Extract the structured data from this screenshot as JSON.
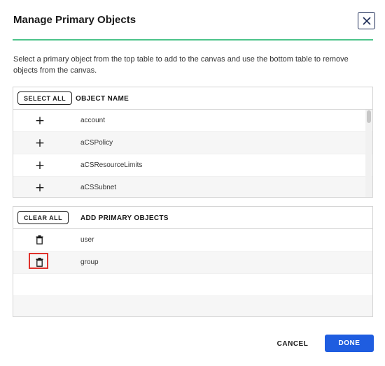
{
  "dialog": {
    "title": "Manage Primary Objects",
    "description": "Select a primary object from the top table to add to the canvas and use the bottom table to remove objects from the canvas."
  },
  "top_table": {
    "button_label": "SELECT ALL",
    "column_header": "OBJECT NAME",
    "row_action_icon": "plus-icon",
    "rows": [
      {
        "name": "account"
      },
      {
        "name": "aCSPolicy"
      },
      {
        "name": "aCSResourceLimits"
      },
      {
        "name": "aCSSubnet"
      }
    ]
  },
  "bottom_table": {
    "button_label": "CLEAR ALL",
    "column_header": "ADD PRIMARY OBJECTS",
    "row_action_icon": "trash-icon",
    "rows": [
      {
        "name": "user"
      },
      {
        "name": "group"
      }
    ]
  },
  "footer": {
    "cancel_label": "CANCEL",
    "done_label": "DONE"
  },
  "colors": {
    "accent": "#1f5de0",
    "divider": "#4cc38a",
    "highlight": "#e0312b"
  }
}
